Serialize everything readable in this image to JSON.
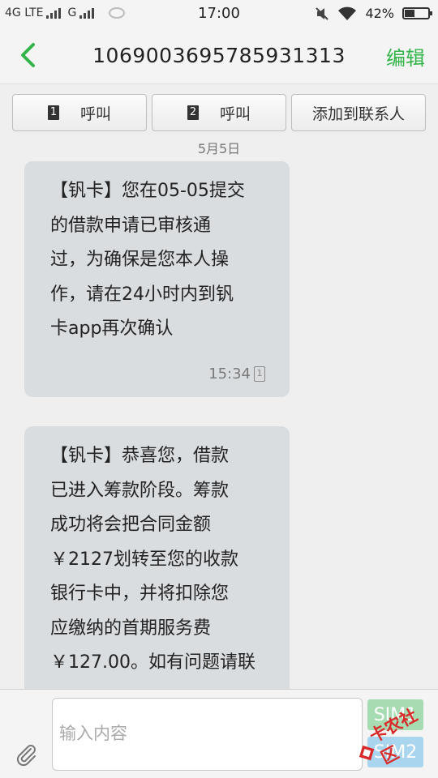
{
  "status_bar": {
    "network_1": "4G LTE",
    "network_2": "G",
    "time": "17:00",
    "battery": "42%",
    "battery_level": 0.42
  },
  "header": {
    "title": "1069003695785931313",
    "edit_label": "编辑",
    "accent": "#33b44a"
  },
  "actions": {
    "call_sim1": {
      "sim": "1",
      "label": "呼叫"
    },
    "call_sim2": {
      "sim": "2",
      "label": "呼叫"
    },
    "add_contact": "添加到联系人"
  },
  "thread": {
    "date": "5月5日",
    "messages": [
      {
        "text": "【钒卡】您在05-05提交\n的借款申请已审核通\n过，为确保是您本人操\n作，请在24小时内到钒\n卡app再次确认",
        "time": "15:34",
        "sim": "1"
      },
      {
        "text": "【钒卡】恭喜您，借款\n已进入筹款阶段。筹款\n成功将会把合同金额\n￥2127划转至您的收款\n银行卡中，并将扣除您\n应缴纳的首期服务费\n￥127.00。如有问题请联"
      }
    ]
  },
  "composer": {
    "placeholder": "输入内容",
    "send_sim1": "SIM1",
    "send_sim2": "SIM2"
  },
  "watermark": {
    "text": "卡农社区"
  }
}
